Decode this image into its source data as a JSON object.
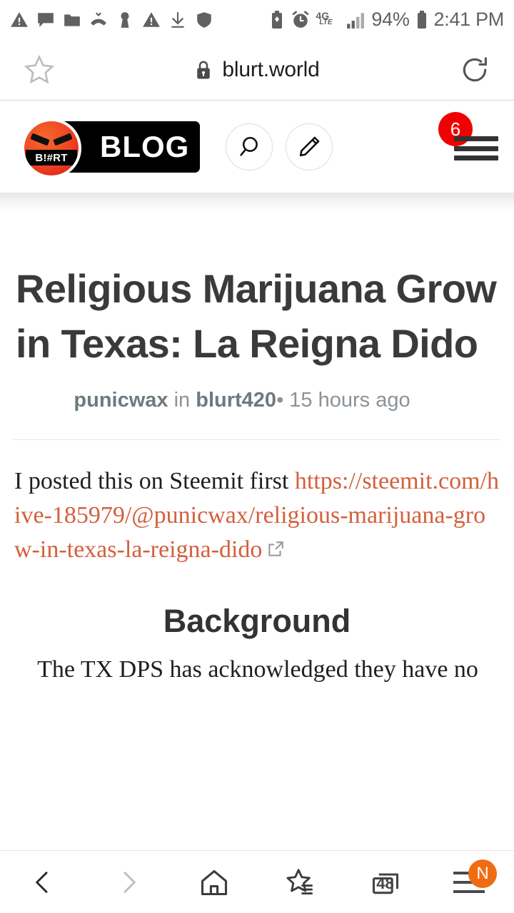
{
  "statusbar": {
    "left_icons": [
      "warning-triangle-icon",
      "chat-bubble-icon",
      "folder-icon",
      "missed-call-icon",
      "keyhole-icon",
      "warning-triangle-icon-2",
      "download-icon",
      "shield-icon"
    ],
    "battery_saver_icon": "battery-saver-icon",
    "alarm_icon": "alarm-clock-icon",
    "network_type": "4G",
    "network_sub": "LTE",
    "signal_icon": "signal-bars-icon",
    "battery_percent": "94%",
    "battery_icon": "battery-icon",
    "clock": "2:41 PM"
  },
  "browser": {
    "bookmark_icon": "star-icon",
    "lock_icon": "lock-icon",
    "url": "blurt.world",
    "reload_icon": "reload-icon"
  },
  "site_header": {
    "logo_tag": "B!#RT",
    "logo_word": "BLOG",
    "search_icon": "search-icon",
    "compose_icon": "pencil-icon",
    "notification_count": "6",
    "menu_icon": "hamburger-menu-icon"
  },
  "post": {
    "title": "Religious Marijuana Grow in Texas: La Reigna Dido",
    "author": "punicwax",
    "in_word": "in",
    "community": "blurt420",
    "separator": "•",
    "timestamp": "15 hours ago",
    "intro": "I posted this on Steemit first",
    "link_text": "https://steemit.com/hive-185979/@punicwax/religious-marijuana-grow-in-texas-la-reigna-dido",
    "external_link_icon": "external-link-icon",
    "section_heading": "Background",
    "paragraph": "The TX DPS has acknowledged they have no"
  },
  "bottomnav": {
    "back_icon": "chevron-left-icon",
    "forward_icon": "chevron-right-icon",
    "home_icon": "home-icon",
    "bookmarks_icon": "bookmarks-star-icon",
    "tabs_icon": "tabs-icon",
    "tab_count": "48",
    "menu_icon": "menu-lines-icon",
    "menu_badge": "N"
  },
  "colors": {
    "link_orange": "#d3603c",
    "badge_red": "#f00101",
    "badge_orange": "#ef6c13",
    "status_grey": "#616161"
  }
}
